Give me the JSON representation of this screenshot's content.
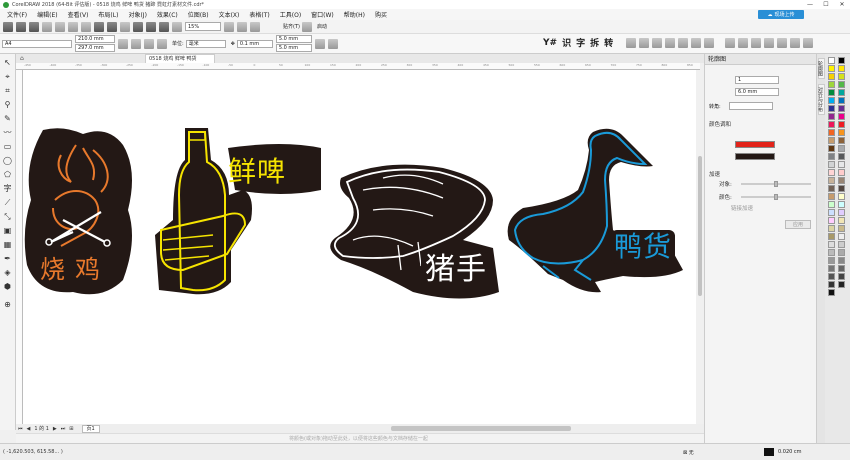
{
  "window": {
    "title": "CorelDRAW 2018 (64-Bit 评估版) - 0518 烧鸡 鲜啤 鸭货 猪蹄 霓虹灯素材文件.cdr*",
    "controls": [
      "—",
      "☐",
      "✕"
    ]
  },
  "menu": {
    "items": [
      "文件(F)",
      "编辑(E)",
      "查看(V)",
      "布局(L)",
      "对象(J)",
      "效果(C)",
      "位图(B)",
      "文本(X)",
      "表格(T)",
      "工具(O)",
      "窗口(W)",
      "帮助(H)",
      "购买"
    ],
    "sync_label": "现场上传"
  },
  "toolbar": {
    "zoom": "15%",
    "snap_label": "贴齐(T)",
    "launch_label": "启动"
  },
  "propertybar": {
    "page_size": "A4",
    "width": "210.0 mm",
    "height": "297.0 mm",
    "units_label": "单位:",
    "units": "毫米",
    "nudge": "0.1 mm",
    "dup_x": "5.0 mm",
    "dup_y": "5.0 mm",
    "text_tools": [
      "Y#",
      "识",
      "字",
      "拆",
      "转"
    ]
  },
  "document": {
    "tab": "0518 烧鸡 鲜啤 鸭货",
    "ruler_ticks": [
      "-450",
      "-400",
      "-350",
      "-300",
      "-250",
      "-200",
      "-150",
      "-100",
      "-50",
      "0",
      "50",
      "100",
      "150",
      "200",
      "250",
      "300",
      "350",
      "400",
      "450",
      "500",
      "550",
      "600",
      "650",
      "700",
      "750",
      "800",
      "850"
    ],
    "page_nav": "1 的 1",
    "page_tab": "页1",
    "hint": "将颜色(或对象)拖动至此处，以便将这些颜色与文档存储在一起"
  },
  "artwork": {
    "roast_chicken": "烧 鸡",
    "fresh_beer": "鲜啤",
    "pig_trotter": "猪手",
    "duck_goods": "鸭货",
    "colors": {
      "orange": "#e8792c",
      "yellow": "#f6e400",
      "white": "#ffffff",
      "blue": "#1a9ad8",
      "plate": "#231815"
    }
  },
  "docker": {
    "title": "轮廓图",
    "steps": "1",
    "offset": "6.0 mm",
    "corners_label": "转角:",
    "color_blend_label": "颜色调和",
    "outline_color": "#e2231a",
    "fill_color": "#231815",
    "accel_label": "加速",
    "object_label": "对象:",
    "color_label": "颜色:",
    "link_label": "链接加速",
    "apply_label": "应用",
    "side_tabs": [
      "轮廓图",
      "对齐与分布"
    ]
  },
  "status": {
    "coords": "( -1,620.503, 615.58... )",
    "fill": "无",
    "outline": "0.020 cm"
  },
  "palette": {
    "colors": [
      "#ffffff",
      "#000000",
      "#fff200",
      "#ffe600",
      "#f7d000",
      "#d4e11b",
      "#9fd63b",
      "#54b848",
      "#008a3e",
      "#00a79d",
      "#00aeef",
      "#0072bc",
      "#2e3192",
      "#662d91",
      "#92278f",
      "#ec008c",
      "#ed145b",
      "#ee1c24",
      "#f26522",
      "#f7941d",
      "#c69c6d",
      "#8c6239",
      "#603813",
      "#a7a9ac",
      "#808285",
      "#58595b",
      "#d1d3d4",
      "#e6e7e8",
      "#ffd5d5",
      "#fcc",
      "#c7b299",
      "#998675",
      "#736357",
      "#534741",
      "#c69c6d",
      "#ffffcc",
      "#ccffcc",
      "#ccffff",
      "#cce0ff",
      "#e0ccff",
      "#ffccff",
      "#f1e5b5",
      "#dbd3a4",
      "#c9b98a",
      "#a89968",
      "#eeeeee",
      "#dddddd",
      "#cccccc",
      "#bbbbbb",
      "#aaaaaa",
      "#999999",
      "#888888",
      "#777777",
      "#666666",
      "#555555",
      "#444444",
      "#333333",
      "#222222",
      "#111111"
    ]
  }
}
